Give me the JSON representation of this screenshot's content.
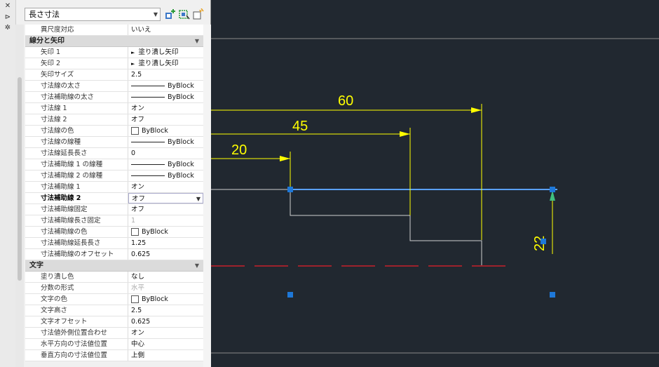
{
  "toolbar": {
    "selector_value": "長さ寸法",
    "close_glyph": "✕",
    "pin_glyph": "⊳",
    "settings_glyph": "✲",
    "dropdown_glyph": "▼"
  },
  "rows_top": [
    {
      "name": "異尺度対応",
      "value": "いいえ"
    }
  ],
  "sections": [
    {
      "title": "線分と矢印",
      "rows": [
        {
          "name": "矢印 1",
          "value": "塗り潰し矢印",
          "kind": "arrow"
        },
        {
          "name": "矢印 2",
          "value": "塗り潰し矢印",
          "kind": "arrow"
        },
        {
          "name": "矢印サイズ",
          "value": "2.5"
        },
        {
          "name": "寸法線の太さ",
          "value": "ByBlock",
          "kind": "line"
        },
        {
          "name": "寸法補助線の太さ",
          "value": "ByBlock",
          "kind": "line"
        },
        {
          "name": "寸法線 1",
          "value": "オン"
        },
        {
          "name": "寸法線 2",
          "value": "オフ"
        },
        {
          "name": "寸法線の色",
          "value": "ByBlock",
          "kind": "color"
        },
        {
          "name": "寸法線の線種",
          "value": "ByBlock",
          "kind": "line"
        },
        {
          "name": "寸法線延長長さ",
          "value": "0"
        },
        {
          "name": "寸法補助線 1 の線種",
          "value": "ByBlock",
          "kind": "line"
        },
        {
          "name": "寸法補助線 2 の線種",
          "value": "ByBlock",
          "kind": "line"
        },
        {
          "name": "寸法補助線 1",
          "value": "オン"
        },
        {
          "name": "寸法補助線 2",
          "value": "オフ",
          "kind": "select"
        },
        {
          "name": "寸法補助線固定",
          "value": "オフ"
        },
        {
          "name": "寸法補助線長さ固定",
          "value": "1",
          "kind": "dim"
        },
        {
          "name": "寸法補助線の色",
          "value": "ByBlock",
          "kind": "color"
        },
        {
          "name": "寸法補助線延長長さ",
          "value": "1.25"
        },
        {
          "name": "寸法補助線のオフセット",
          "value": "0.625"
        }
      ]
    },
    {
      "title": "文字",
      "rows": [
        {
          "name": "塗り潰し色",
          "value": "なし"
        },
        {
          "name": "分数の形式",
          "value": "水平",
          "kind": "dim"
        },
        {
          "name": "文字の色",
          "value": "ByBlock",
          "kind": "color"
        },
        {
          "name": "文字高さ",
          "value": "2.5"
        },
        {
          "name": "文字オフセット",
          "value": "0.625"
        },
        {
          "name": "寸法値外側位置合わせ",
          "value": "オン"
        },
        {
          "name": "水平方向の寸法値位置",
          "value": "中心"
        },
        {
          "name": "垂直方向の寸法値位置",
          "value": "上側"
        }
      ]
    }
  ],
  "drawing": {
    "dim_labels": [
      "60",
      "45",
      "20",
      "22"
    ],
    "colors": {
      "background": "#212830",
      "dimension": "#ffff00",
      "grip": "#1e78d8",
      "selected": "#5aa0ff",
      "object": "#cfcfcf",
      "hidden_line": "#c8202a"
    }
  }
}
